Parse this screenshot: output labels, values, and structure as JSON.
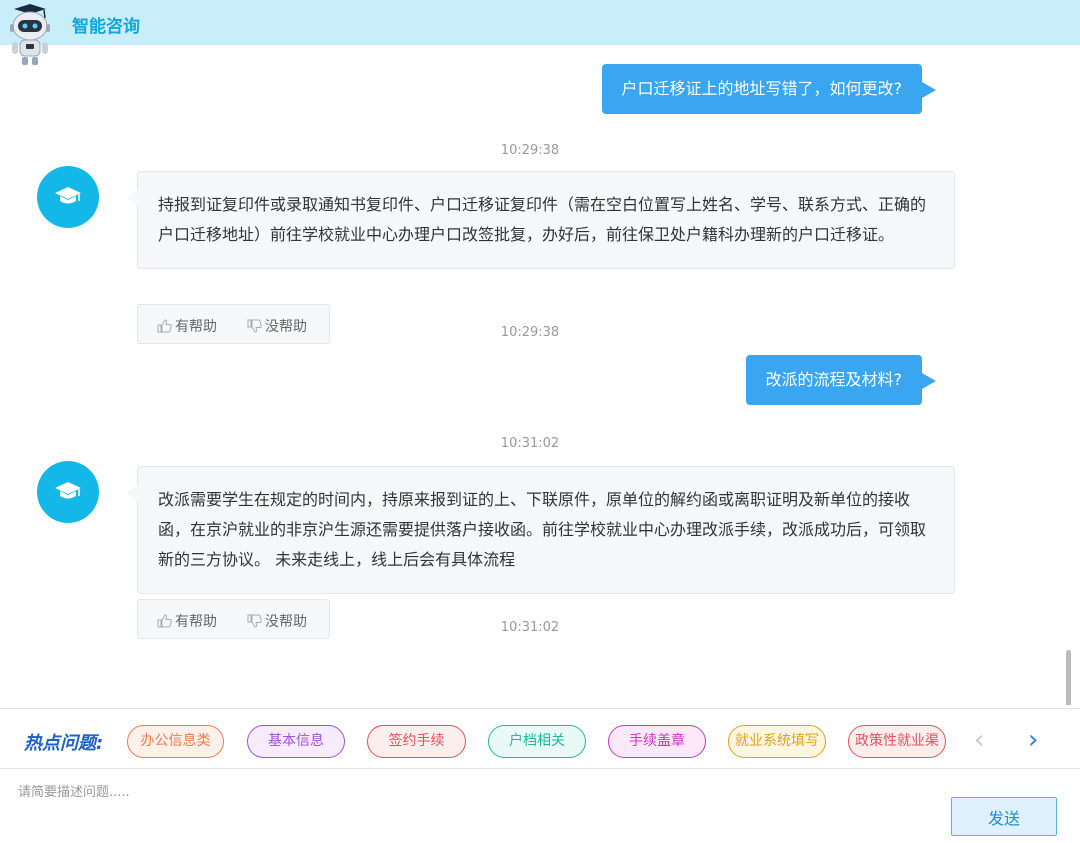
{
  "header": {
    "title": "智能咨询"
  },
  "messages": [
    {
      "role": "user",
      "text": "户口迁移证上的地址写错了，如何更改?"
    },
    {
      "role": "time",
      "text": "10:29:38"
    },
    {
      "role": "bot",
      "text": "持报到证复印件或录取通知书复印件、户口迁移证复印件（需在空白位置写上姓名、学号、联系方式、正确的户口迁移地址）前往学校就业中心办理户口改签批复，办好后，前往保卫处户籍科办理新的户口迁移证。"
    },
    {
      "role": "time",
      "text": "10:29:38"
    },
    {
      "role": "user",
      "text": "改派的流程及材料?"
    },
    {
      "role": "time",
      "text": "10:31:02"
    },
    {
      "role": "bot",
      "text": "改派需要学生在规定的时间内，持原来报到证的上、下联原件，原单位的解约函或离职证明及新单位的接收函，在京沪就业的非京沪生源还需要提供落户接收函。前往学校就业中心办理改派手续，改派成功后，可领取新的三方协议。 未来走线上，线上后会有具体流程"
    },
    {
      "role": "time",
      "text": "10:31:02"
    }
  ],
  "feedback": {
    "helpful": "有帮助",
    "not_helpful": "没帮助"
  },
  "hot": {
    "title": "热点问题:",
    "tags": [
      {
        "label": "办公信息类",
        "color": "#f07a4a",
        "bg": "#fff1ea"
      },
      {
        "label": "基本信息",
        "color": "#a052d6",
        "bg": "#f6ecfd"
      },
      {
        "label": "签约手续",
        "color": "#e8505b",
        "bg": "#fdeeee"
      },
      {
        "label": "户档相关",
        "color": "#25b5a0",
        "bg": "#e9f9f5"
      },
      {
        "label": "手续盖章",
        "color": "#d132c8",
        "bg": "#fbe9fa"
      },
      {
        "label": "就业系统填写",
        "color": "#e2a218",
        "bg": "#fdf6e2"
      },
      {
        "label": "政策性就业渠",
        "color": "#e8505b",
        "bg": "#fdeeee"
      }
    ],
    "prev": "‹",
    "next": "›"
  },
  "input": {
    "placeholder": "请简要描述问题.....",
    "send": "发送"
  }
}
